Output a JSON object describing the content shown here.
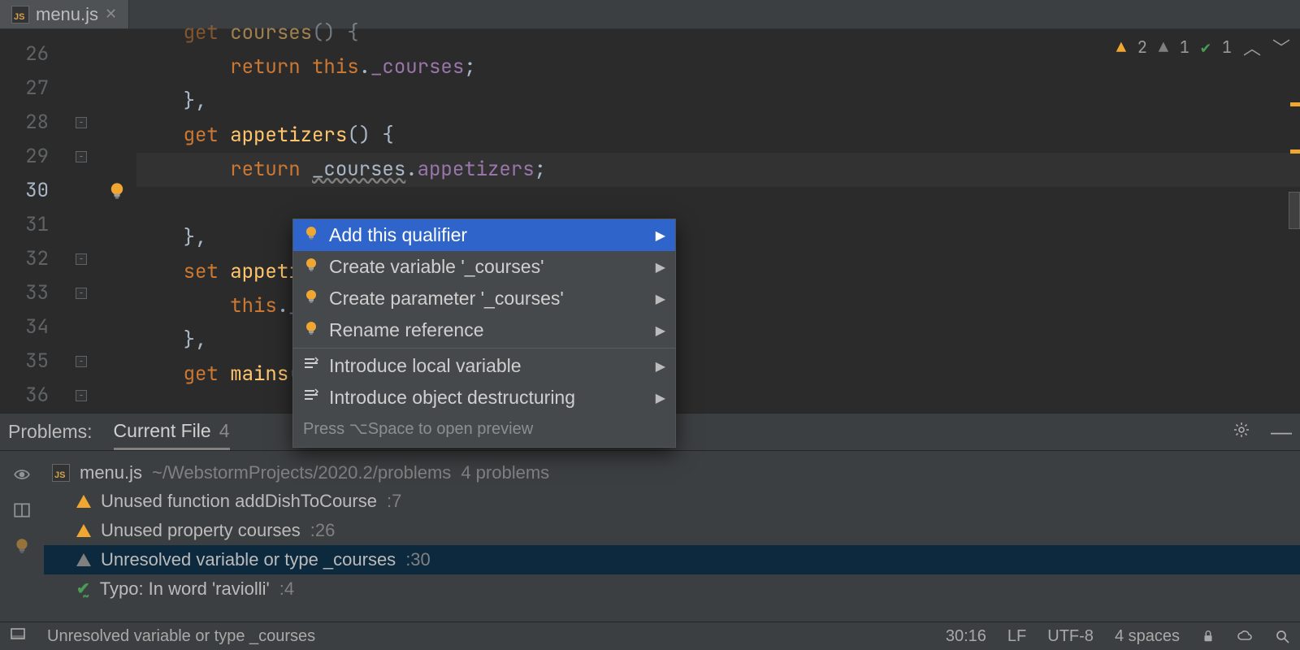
{
  "tab": {
    "filename": "menu.js"
  },
  "gutter": {
    "lines": [
      "26",
      "27",
      "28",
      "29",
      "30",
      "31",
      "32",
      "33",
      "34",
      "35",
      "36"
    ],
    "current_index": 4,
    "fold_handles": [
      2,
      3,
      6,
      7,
      9,
      10
    ],
    "bulb_index": 4
  },
  "code": {
    "lines": [
      {
        "tokens": [
          {
            "t": "    ",
            "c": "pl"
          },
          {
            "t": "get",
            "c": "kw"
          },
          {
            "t": " ",
            "c": "pl"
          },
          {
            "t": "courses",
            "c": "fn"
          },
          {
            "t": "()",
            "c": "pl"
          },
          {
            "t": " {",
            "c": "pl"
          }
        ],
        "partial_top": true
      },
      {
        "tokens": [
          {
            "t": "        ",
            "c": "pl"
          },
          {
            "t": "return",
            "c": "kw"
          },
          {
            "t": " ",
            "c": "pl"
          },
          {
            "t": "this",
            "c": "kw"
          },
          {
            "t": ".",
            "c": "pl"
          },
          {
            "t": "_courses",
            "c": "prop"
          },
          {
            "t": ";",
            "c": "pl"
          }
        ]
      },
      {
        "tokens": [
          {
            "t": "    },",
            "c": "pl"
          }
        ]
      },
      {
        "tokens": [
          {
            "t": "    ",
            "c": "pl"
          },
          {
            "t": "get",
            "c": "kw"
          },
          {
            "t": " ",
            "c": "pl"
          },
          {
            "t": "appetizers",
            "c": "fn"
          },
          {
            "t": "()",
            "c": "pl"
          },
          {
            "t": " {",
            "c": "pl"
          }
        ]
      },
      {
        "active": true,
        "tokens": [
          {
            "t": "        ",
            "c": "pl"
          },
          {
            "t": "return",
            "c": "kw"
          },
          {
            "t": " ",
            "c": "pl"
          },
          {
            "t": "_courses",
            "c": "pl squig"
          },
          {
            "t": ".",
            "c": "pl"
          },
          {
            "t": "appetizers",
            "c": "prop"
          },
          {
            "t": ";",
            "c": "pl"
          }
        ]
      },
      {
        "tokens": [
          {
            "t": " ",
            "c": "pl"
          }
        ]
      },
      {
        "tokens": [
          {
            "t": "    },",
            "c": "pl"
          }
        ]
      },
      {
        "tokens": [
          {
            "t": "    ",
            "c": "pl"
          },
          {
            "t": "set",
            "c": "kw"
          },
          {
            "t": " ",
            "c": "pl"
          },
          {
            "t": "appetiz",
            "c": "fn"
          }
        ]
      },
      {
        "tokens": [
          {
            "t": "        ",
            "c": "pl"
          },
          {
            "t": "this",
            "c": "kw"
          },
          {
            "t": ".",
            "c": "pl"
          },
          {
            "t": "_c",
            "c": "prop"
          }
        ]
      },
      {
        "tokens": [
          {
            "t": "    },",
            "c": "pl"
          }
        ]
      },
      {
        "tokens": [
          {
            "t": "    ",
            "c": "pl"
          },
          {
            "t": "get",
            "c": "kw"
          },
          {
            "t": " ",
            "c": "pl"
          },
          {
            "t": "mains",
            "c": "fn"
          },
          {
            "t": "()",
            "c": "pl"
          }
        ]
      }
    ]
  },
  "inspections": {
    "warn": "2",
    "weak": "1",
    "ok": "1"
  },
  "intention_popup": {
    "items": [
      {
        "icon": "bulb",
        "label": "Add this qualifier",
        "submenu": true,
        "selected": true
      },
      {
        "icon": "bulb",
        "label": "Create variable '_courses'",
        "submenu": true
      },
      {
        "icon": "bulb",
        "label": "Create parameter '_courses'",
        "submenu": true
      },
      {
        "icon": "bulb",
        "label": "Rename reference",
        "submenu": true
      },
      {
        "separator": true
      },
      {
        "icon": "refactor",
        "label": "Introduce local variable",
        "submenu": true
      },
      {
        "icon": "refactor",
        "label": "Introduce object destructuring",
        "submenu": true
      }
    ],
    "hint": "Press ⌥Space to open preview"
  },
  "problems_panel": {
    "title": "Problems:",
    "tab": {
      "label": "Current File",
      "count": "4"
    },
    "file": {
      "name": "menu.js",
      "path": "~/WebstormProjects/2020.2/problems",
      "count_label": "4 problems"
    },
    "items": [
      {
        "icon": "warn",
        "text": "Unused function addDishToCourse",
        "loc": ":7"
      },
      {
        "icon": "warn",
        "text": "Unused property courses",
        "loc": ":26"
      },
      {
        "icon": "weak",
        "text": "Unresolved variable or type _courses",
        "loc": ":30",
        "selected": true
      },
      {
        "icon": "typo",
        "text": "Typo: In word 'raviolli'",
        "loc": ":4"
      }
    ]
  },
  "status_bar": {
    "message": "Unresolved variable or type _courses",
    "pos": "30:16",
    "eol": "LF",
    "enc": "UTF-8",
    "indent": "4 spaces"
  }
}
